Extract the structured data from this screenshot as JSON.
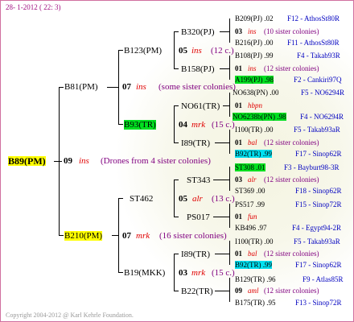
{
  "header": "28-  1-2012 ( 22:  3)",
  "footer": "Copyright 2004-2012 @ Karl Kehrle Foundation.",
  "root": {
    "id": "B89(PM)",
    "gen": "09",
    "type": "ins",
    "note": "(Drones from 4 sister colonies)"
  },
  "gen1": [
    {
      "id": "B81(PM)",
      "gen": "07",
      "type": "ins",
      "note": "(some sister colonies)"
    },
    {
      "id": "B210(PM)",
      "gen": "07",
      "type": "mrk",
      "note": "(16 sister colonies)"
    }
  ],
  "gen2": [
    {
      "id": "B123(PM)",
      "gen": "05",
      "type": "ins",
      "note": "(12 c.)"
    },
    {
      "id": "B93(TR)",
      "gen": "04",
      "type": "mrk",
      "note": "(15 c.)"
    },
    {
      "id": "ST462",
      "gen": "05",
      "type": "alr",
      "note": "(13 c.)"
    },
    {
      "id": "B19(MKK)",
      "gen": "03",
      "type": "mrk",
      "note": "(15 c.)"
    }
  ],
  "gen3": [
    "B320(PJ)",
    "B158(PJ)",
    "NO61(TR)",
    "I89(TR)",
    "ST343",
    "PS017",
    "I89(TR)",
    "B22(TR)"
  ],
  "gen4": [
    {
      "top": "B209(PJ) .02",
      "topCode": "F12 - AthosSt80R",
      "gen": "03",
      "type": "ins",
      "note": "(10 sister colonies)",
      "bot": "B216(PJ) .00",
      "botCode": "F11 - AthosSt80R"
    },
    {
      "top": "B108(PJ) .99",
      "topCode": "F4 - Takab93R",
      "gen": "01",
      "type": "ins",
      "note": "(12 sister colonies)",
      "bot": "A199(PJ) .98",
      "botCode": "F2 - Cankiri97Q"
    },
    {
      "top": "NO638(PN) .00",
      "topCode": "F5 - NO6294R",
      "gen": "01",
      "type": "hbpn",
      "note": "",
      "bot": "NO6238b(PN) .98",
      "botCode": "F4 - NO6294R"
    },
    {
      "top": "I100(TR) .00",
      "topCode": "F5 - Takab93aR",
      "gen": "01",
      "type": "bal",
      "note": "(12 sister colonies)",
      "bot": "B92(TR) .99",
      "botCode": "F17 - Sinop62R"
    },
    {
      "top": "ST308 .01",
      "topCode": "F3 - Bayburt98-3R",
      "gen": "03",
      "type": "alr",
      "note": "(12 sister colonies)",
      "bot": "ST369 .00",
      "botCode": "F18 - Sinop62R"
    },
    {
      "top": "PS517 .99",
      "topCode": "F15 - Sinop72R",
      "gen": "01",
      "type": "fun",
      "note": "",
      "bot": "KB496 .97",
      "botCode": "F4 - Egypt94-2R"
    },
    {
      "top": "I100(TR) .00",
      "topCode": "F5 - Takab93aR",
      "gen": "01",
      "type": "bal",
      "note": "(12 sister colonies)",
      "bot": "B92(TR) .99",
      "botCode": "F17 - Sinop62R"
    },
    {
      "top": "B129(TR) .96",
      "topCode": "F9 - Atlas85R",
      "gen": "09",
      "type": "aml",
      "note": "(12 sister colonies)",
      "bot": "B175(TR) .95",
      "botCode": "F13 - Sinop72R"
    }
  ]
}
